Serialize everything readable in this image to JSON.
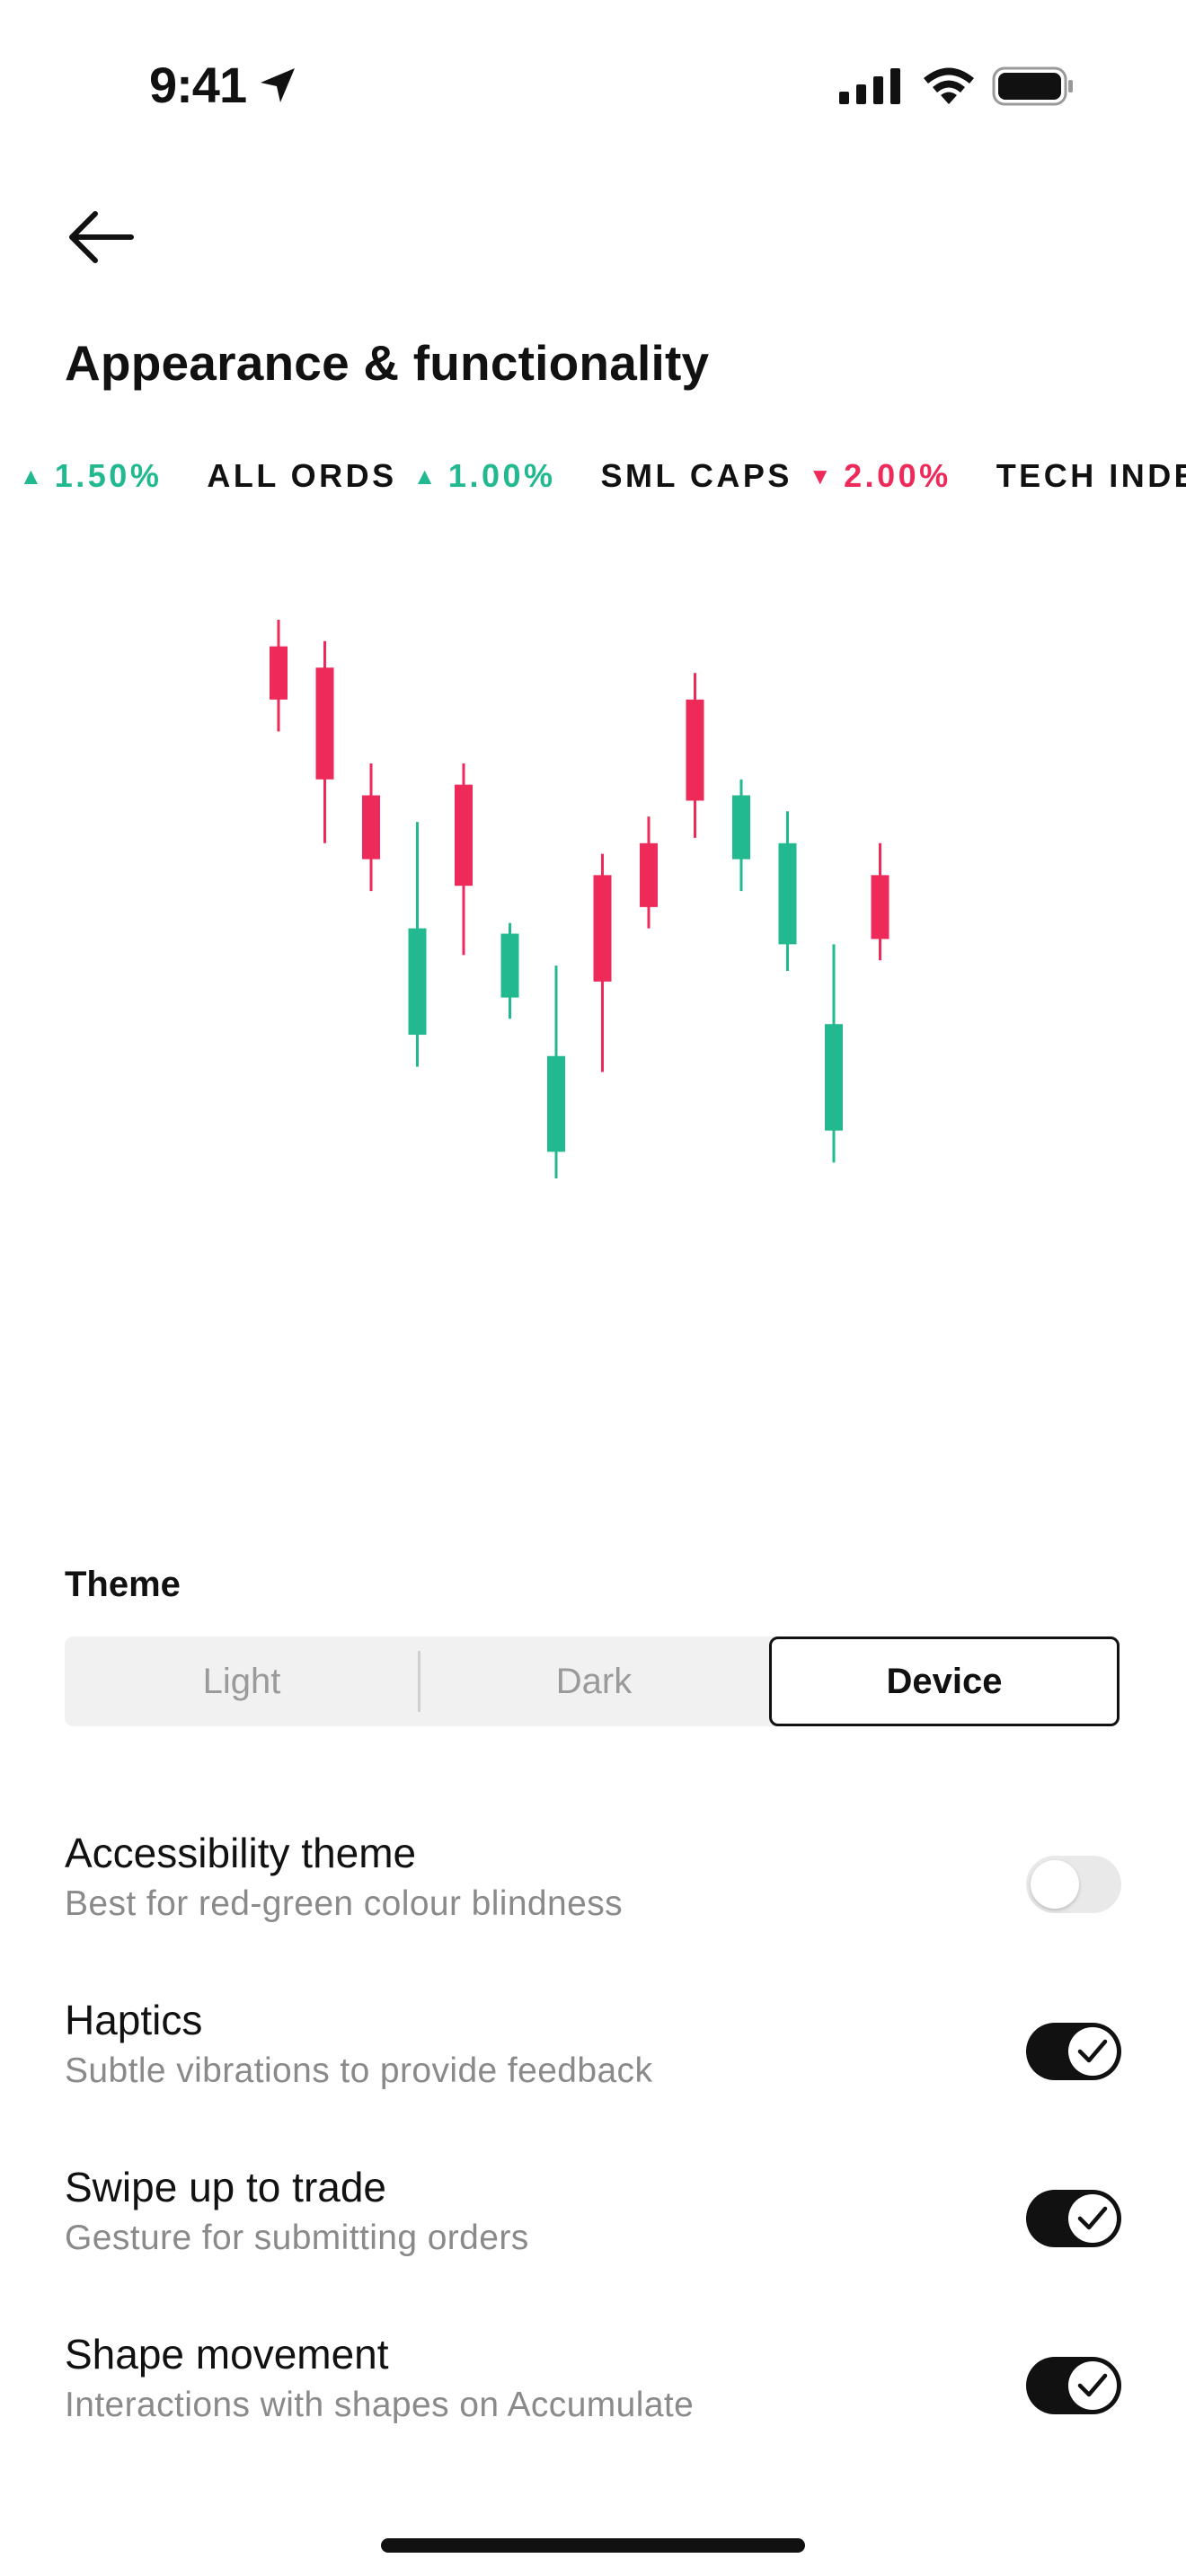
{
  "status_bar": {
    "time": "9:41"
  },
  "header": {
    "title": "Appearance & functionality"
  },
  "ticker": [
    {
      "name": "",
      "pct": "1.50%",
      "dir": "up",
      "partial_left": "0"
    },
    {
      "name": "ALL ORDS",
      "pct": "1.00%",
      "dir": "up"
    },
    {
      "name": "SML CAPS",
      "pct": "2.00%",
      "dir": "down"
    },
    {
      "name": "TECH INDE",
      "pct": "",
      "dir": ""
    }
  ],
  "chart_data": {
    "type": "candlestick",
    "colors": {
      "up": "#22b890",
      "down": "#ee2a5b"
    },
    "candles": [
      {
        "dir": "down",
        "high": 100,
        "open": 95,
        "close": 85,
        "low": 79
      },
      {
        "dir": "down",
        "high": 96,
        "open": 91,
        "close": 70,
        "low": 58
      },
      {
        "dir": "down",
        "high": 73,
        "open": 67,
        "close": 55,
        "low": 49
      },
      {
        "dir": "up",
        "high": 62,
        "open": 22,
        "close": 42,
        "low": 16
      },
      {
        "dir": "down",
        "high": 73,
        "open": 69,
        "close": 50,
        "low": 37
      },
      {
        "dir": "up",
        "high": 43,
        "open": 29,
        "close": 41,
        "low": 25
      },
      {
        "dir": "up",
        "high": 35,
        "open": 0,
        "close": 18,
        "low": -5
      },
      {
        "dir": "down",
        "high": 56,
        "open": 52,
        "close": 32,
        "low": 15
      },
      {
        "dir": "down",
        "high": 63,
        "open": 58,
        "close": 46,
        "low": 42
      },
      {
        "dir": "down",
        "high": 90,
        "open": 85,
        "close": 66,
        "low": 59
      },
      {
        "dir": "up",
        "high": 70,
        "open": 55,
        "close": 67,
        "low": 49
      },
      {
        "dir": "up",
        "high": 64,
        "open": 39,
        "close": 58,
        "low": 34
      },
      {
        "dir": "up",
        "high": 39,
        "open": 4,
        "close": 24,
        "low": -2
      },
      {
        "dir": "down",
        "high": 58,
        "open": 52,
        "close": 40,
        "low": 36
      }
    ]
  },
  "theme": {
    "label": "Theme",
    "options": [
      "Light",
      "Dark",
      "Device"
    ],
    "selected": "Device"
  },
  "settings": [
    {
      "title": "Accessibility theme",
      "subtitle": "Best for red-green colour blindness",
      "on": false
    },
    {
      "title": "Haptics",
      "subtitle": "Subtle vibrations to provide feedback",
      "on": true
    },
    {
      "title": "Swipe up to trade",
      "subtitle": "Gesture for submitting orders",
      "on": true
    },
    {
      "title": "Shape movement",
      "subtitle": "Interactions with shapes on Accumulate",
      "on": true
    }
  ]
}
